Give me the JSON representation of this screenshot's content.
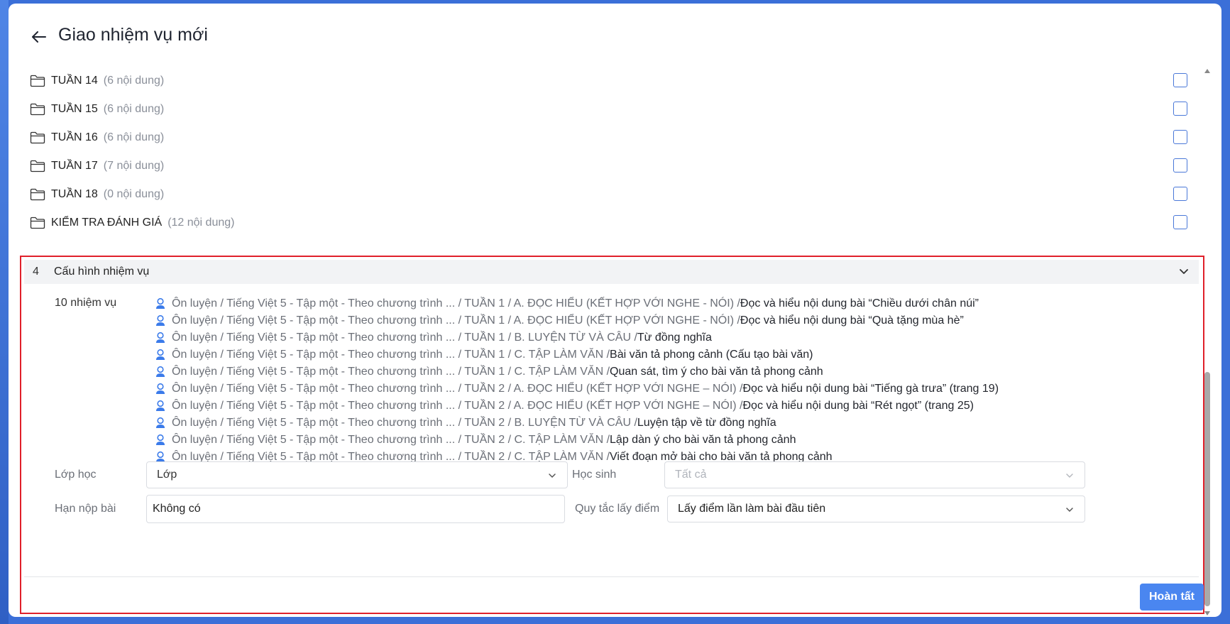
{
  "header": {
    "title": "Giao nhiệm vụ mới"
  },
  "folders": [
    {
      "name": "TUẦN 14",
      "count": "(6 nội dung)"
    },
    {
      "name": "TUẦN 15",
      "count": "(6 nội dung)"
    },
    {
      "name": "TUẦN 16",
      "count": "(6 nội dung)"
    },
    {
      "name": "TUẦN 17",
      "count": "(7 nội dung)"
    },
    {
      "name": "TUẦN 18",
      "count": "(0 nội dung)"
    },
    {
      "name": "KIỂM TRA ĐÁNH GIÁ",
      "count": "(12 nội dung)"
    }
  ],
  "config": {
    "step_number": "4",
    "section_title": "Cấu hình nhiệm vụ",
    "tasks_label": "10 nhiệm vụ",
    "tasks": [
      {
        "path": "Ôn luyện / Tiếng Việt 5 - Tập một - Theo chương trình ... / TUẦN 1 / A. ĐỌC HIỂU (KẾT HỢP VỚI NGHE - NÓI) / ",
        "name": "Đọc và hiểu nội dung bài “Chiều dưới chân núi”"
      },
      {
        "path": "Ôn luyện / Tiếng Việt 5 - Tập một - Theo chương trình ... / TUẦN 1 / A. ĐỌC HIỂU (KẾT HỢP VỚI NGHE - NÓI) / ",
        "name": "Đọc và hiểu nội dung bài “Quà tặng mùa hè”"
      },
      {
        "path": "Ôn luyện / Tiếng Việt 5 - Tập một - Theo chương trình ... / TUẦN 1 / B. LUYỆN TỪ VÀ CÂU / ",
        "name": "Từ đồng nghĩa"
      },
      {
        "path": "Ôn luyện / Tiếng Việt 5 - Tập một - Theo chương trình ... / TUẦN 1 / C. TẬP LÀM VĂN / ",
        "name": "Bài văn tả phong cảnh (Cấu tạo bài văn)"
      },
      {
        "path": "Ôn luyện / Tiếng Việt 5 - Tập một - Theo chương trình ... / TUẦN 1 / C. TẬP LÀM VĂN / ",
        "name": "Quan sát, tìm ý cho bài văn tả phong cảnh"
      },
      {
        "path": "Ôn luyện / Tiếng Việt 5 - Tập một - Theo chương trình ... / TUẦN 2 / A. ĐỌC HIỂU (KẾT HỢP VỚI NGHE – NÓI) / ",
        "name": "Đọc và hiểu nội dung bài “Tiếng gà trưa” (trang 19)"
      },
      {
        "path": "Ôn luyện / Tiếng Việt 5 - Tập một - Theo chương trình ... / TUẦN 2 / A. ĐỌC HIỂU (KẾT HỢP VỚI NGHE – NÓI) / ",
        "name": "Đọc và hiểu nội dung bài “Rét ngọt” (trang 25)"
      },
      {
        "path": "Ôn luyện / Tiếng Việt 5 - Tập một - Theo chương trình ... / TUẦN 2 / B. LUYỆN TỪ VÀ CÂU / ",
        "name": "Luyện tập về từ đồng nghĩa"
      },
      {
        "path": "Ôn luyện / Tiếng Việt 5 - Tập một - Theo chương trình ... / TUẦN 2 / C. TẬP LÀM VĂN / ",
        "name": "Lập dàn ý cho bài văn tả phong cảnh"
      },
      {
        "path": "Ôn luyện / Tiếng Việt 5 - Tập một - Theo chương trình ... / TUẦN 2 / C. TẬP LÀM VĂN / ",
        "name": "Viết đoạn mở bài cho bài văn tả phong cảnh"
      }
    ],
    "class_label": "Lớp học",
    "class_select_value": "Lớp",
    "student_label": "Học sinh",
    "student_select_value": "Tất cả",
    "deadline_label": "Hạn nộp bài",
    "deadline_value": "Không có",
    "score_rule_label": "Quy tắc lấy điểm",
    "score_rule_value": "Lấy điểm lần làm bài đầu tiên",
    "finish_label": "Hoàn tất"
  },
  "colors": {
    "accent": "#4a86f0",
    "highlight_border": "#e0202a",
    "checkbox_border": "#4a78d8"
  }
}
